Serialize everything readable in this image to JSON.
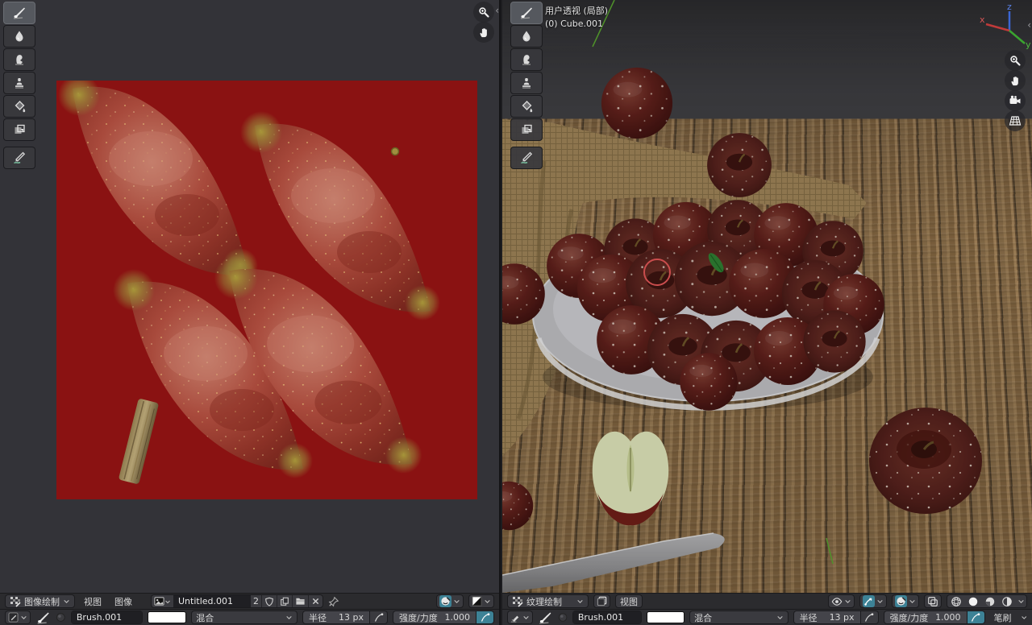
{
  "image_editor": {
    "header": {
      "editor_type": "图像绘制",
      "menus": {
        "view": "视图",
        "image": "图像"
      },
      "image_name": "Untitled.001",
      "image_users": "2"
    },
    "tool_settings": {
      "brush_name": "Brush.001",
      "blend_mode": "混合",
      "radius_label": "半径",
      "radius_value": "13 px",
      "strength_label": "强度/力度",
      "strength_value": "1.000"
    }
  },
  "viewport": {
    "overlay": {
      "view_mode": "用户透视 (局部)",
      "active_object": "(0) Cube.001"
    },
    "header": {
      "mode": "纹理绘制",
      "menus": {
        "view": "视图"
      }
    },
    "tool_settings": {
      "brush_name": "Brush.001",
      "blend_mode": "混合",
      "radius_label": "半径",
      "radius_value": "13 px",
      "strength_label": "强度/力度",
      "strength_value": "1.000",
      "brush_panel": "笔刷"
    },
    "gizmo_axes": {
      "x": "x",
      "y": "y",
      "z": "z"
    }
  },
  "colors": {
    "accent_teal": "#3d8296",
    "uv_background_red": "#8a1212",
    "apple_dark_red": "#5e1f1a",
    "wood_tan": "#9a7b52"
  }
}
